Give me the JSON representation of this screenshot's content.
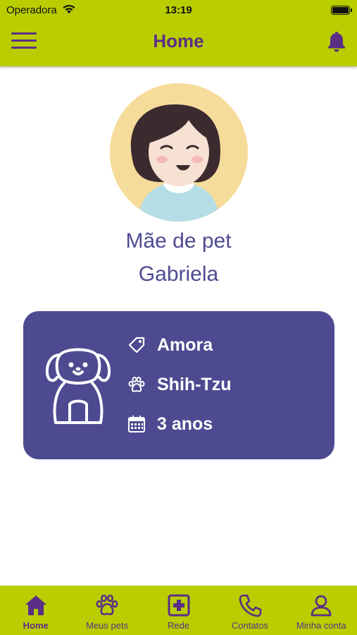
{
  "status_bar": {
    "carrier": "Operadora",
    "time": "13:19"
  },
  "header": {
    "title": "Home",
    "menu_icon": "hamburger-menu-icon",
    "notification_icon": "bell-icon"
  },
  "profile": {
    "role": "Mãe de pet",
    "name": "Gabriela"
  },
  "pet": {
    "name": "Amora",
    "breed": "Shih-Tzu",
    "age": "3 anos",
    "name_icon": "tag-icon",
    "breed_icon": "paw-icon",
    "age_icon": "calendar-icon"
  },
  "bottom_nav": {
    "items": [
      {
        "label": "Home",
        "icon": "home-icon",
        "active": true
      },
      {
        "label": "Meus pets",
        "icon": "paw-icon",
        "active": false
      },
      {
        "label": "Rede",
        "icon": "medical-cross-icon",
        "active": false
      },
      {
        "label": "Contatos",
        "icon": "phone-icon",
        "active": false
      },
      {
        "label": "Minha conta",
        "icon": "user-icon",
        "active": false
      }
    ]
  },
  "colors": {
    "accent_green": "#b9cd00",
    "brand_purple": "#5b2f86",
    "card_indigo": "#4e4a91",
    "avatar_background": "#f5dc9a"
  }
}
